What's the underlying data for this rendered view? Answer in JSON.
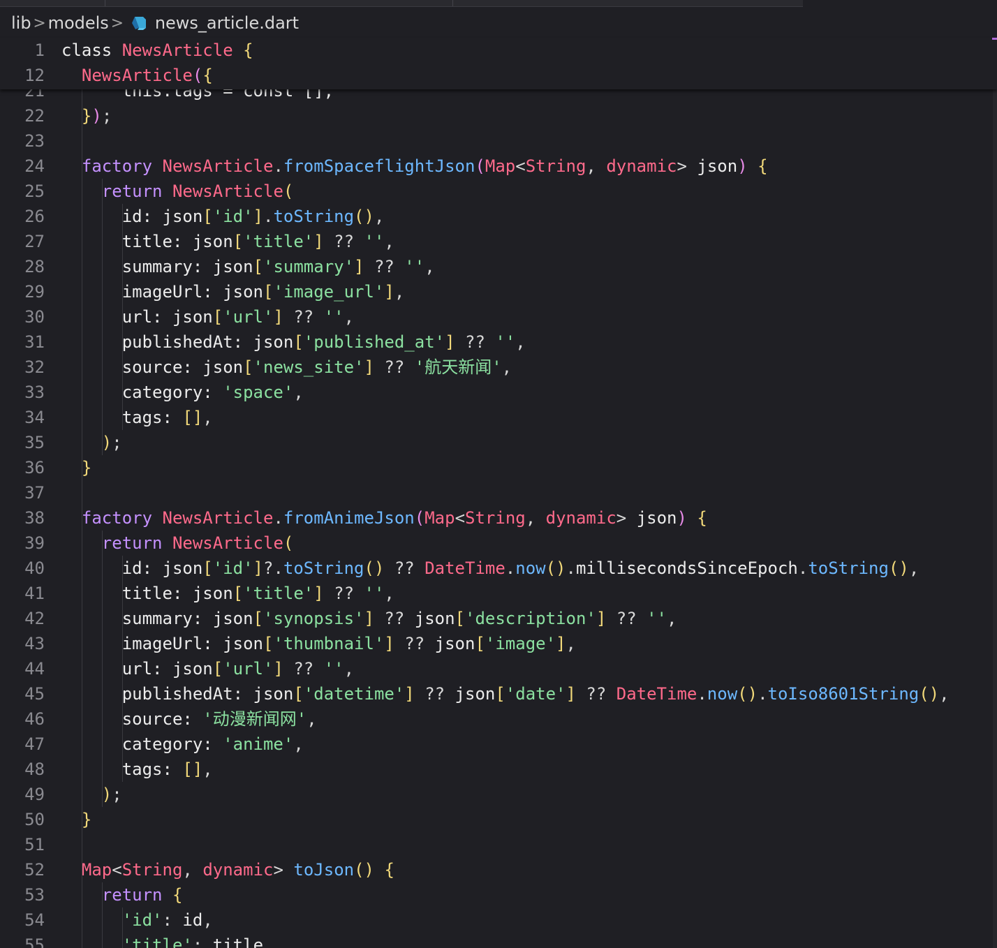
{
  "breadcrumb": {
    "items": [
      "lib",
      "models",
      "news_article.dart"
    ],
    "separator": ">"
  },
  "colors": {
    "background": "#1f1f24",
    "keyword": "#c591ff",
    "class_name": "#ff6a8b",
    "function": "#6db8ff",
    "string": "#8be0a0",
    "bracket": "#f2d97a",
    "line_number": "#8a8a90"
  },
  "editor": {
    "sticky_lines": [
      {
        "n": "1",
        "tokens": [
          [
            "kw-plain",
            "class "
          ],
          [
            "cl",
            "NewsArticle"
          ],
          [
            "pl",
            " "
          ],
          [
            "br",
            "{"
          ]
        ]
      },
      {
        "n": "12",
        "tokens": [
          [
            "pl",
            "  "
          ],
          [
            "cl",
            "NewsArticle"
          ],
          [
            "br2",
            "("
          ],
          [
            "br",
            "{"
          ]
        ]
      }
    ],
    "partial_line": {
      "n": "21",
      "text": "      this.tags = const [],"
    },
    "lines": [
      {
        "n": "22",
        "tokens": [
          [
            "pl",
            "  "
          ],
          [
            "br",
            "}"
          ],
          [
            "br2",
            ")"
          ],
          [
            "op",
            ";"
          ]
        ]
      },
      {
        "n": "23",
        "tokens": []
      },
      {
        "n": "24",
        "tokens": [
          [
            "pl",
            "  "
          ],
          [
            "kw",
            "factory "
          ],
          [
            "cl",
            "NewsArticle"
          ],
          [
            "op",
            "."
          ],
          [
            "fn",
            "fromSpaceflightJson"
          ],
          [
            "br2",
            "("
          ],
          [
            "cl",
            "Map"
          ],
          [
            "op",
            "<"
          ],
          [
            "cl",
            "String"
          ],
          [
            "op",
            ", "
          ],
          [
            "cl",
            "dynamic"
          ],
          [
            "op",
            "> "
          ],
          [
            "pl",
            "json"
          ],
          [
            "br2",
            ")"
          ],
          [
            "pl",
            " "
          ],
          [
            "br",
            "{"
          ]
        ]
      },
      {
        "n": "25",
        "tokens": [
          [
            "pl",
            "    "
          ],
          [
            "kw",
            "return "
          ],
          [
            "cl",
            "NewsArticle"
          ],
          [
            "br",
            "("
          ]
        ]
      },
      {
        "n": "26",
        "tokens": [
          [
            "pl",
            "      id: json"
          ],
          [
            "br",
            "["
          ],
          [
            "st",
            "'id'"
          ],
          [
            "br",
            "]"
          ],
          [
            "op",
            "."
          ],
          [
            "fn",
            "toString"
          ],
          [
            "br",
            "()"
          ],
          [
            "op",
            ","
          ]
        ]
      },
      {
        "n": "27",
        "tokens": [
          [
            "pl",
            "      title: json"
          ],
          [
            "br",
            "["
          ],
          [
            "st",
            "'title'"
          ],
          [
            "br",
            "]"
          ],
          [
            "op",
            " ?? "
          ],
          [
            "st",
            "''"
          ],
          [
            "op",
            ","
          ]
        ]
      },
      {
        "n": "28",
        "tokens": [
          [
            "pl",
            "      summary: json"
          ],
          [
            "br",
            "["
          ],
          [
            "st",
            "'summary'"
          ],
          [
            "br",
            "]"
          ],
          [
            "op",
            " ?? "
          ],
          [
            "st",
            "''"
          ],
          [
            "op",
            ","
          ]
        ]
      },
      {
        "n": "29",
        "tokens": [
          [
            "pl",
            "      imageUrl: json"
          ],
          [
            "br",
            "["
          ],
          [
            "st",
            "'image_url'"
          ],
          [
            "br",
            "]"
          ],
          [
            "op",
            ","
          ]
        ]
      },
      {
        "n": "30",
        "tokens": [
          [
            "pl",
            "      url: json"
          ],
          [
            "br",
            "["
          ],
          [
            "st",
            "'url'"
          ],
          [
            "br",
            "]"
          ],
          [
            "op",
            " ?? "
          ],
          [
            "st",
            "''"
          ],
          [
            "op",
            ","
          ]
        ]
      },
      {
        "n": "31",
        "tokens": [
          [
            "pl",
            "      publishedAt: json"
          ],
          [
            "br",
            "["
          ],
          [
            "st",
            "'published_at'"
          ],
          [
            "br",
            "]"
          ],
          [
            "op",
            " ?? "
          ],
          [
            "st",
            "''"
          ],
          [
            "op",
            ","
          ]
        ]
      },
      {
        "n": "32",
        "tokens": [
          [
            "pl",
            "      source: json"
          ],
          [
            "br",
            "["
          ],
          [
            "st",
            "'news_site'"
          ],
          [
            "br",
            "]"
          ],
          [
            "op",
            " ?? "
          ],
          [
            "st",
            "'航天新闻'"
          ],
          [
            "op",
            ","
          ]
        ]
      },
      {
        "n": "33",
        "tokens": [
          [
            "pl",
            "      category: "
          ],
          [
            "st",
            "'space'"
          ],
          [
            "op",
            ","
          ]
        ]
      },
      {
        "n": "34",
        "tokens": [
          [
            "pl",
            "      tags: "
          ],
          [
            "br",
            "[]"
          ],
          [
            "op",
            ","
          ]
        ]
      },
      {
        "n": "35",
        "tokens": [
          [
            "pl",
            "    "
          ],
          [
            "br",
            ")"
          ],
          [
            "op",
            ";"
          ]
        ]
      },
      {
        "n": "36",
        "tokens": [
          [
            "pl",
            "  "
          ],
          [
            "br",
            "}"
          ]
        ]
      },
      {
        "n": "37",
        "tokens": []
      },
      {
        "n": "38",
        "tokens": [
          [
            "pl",
            "  "
          ],
          [
            "kw",
            "factory "
          ],
          [
            "cl",
            "NewsArticle"
          ],
          [
            "op",
            "."
          ],
          [
            "fn",
            "fromAnimeJson"
          ],
          [
            "br2",
            "("
          ],
          [
            "cl",
            "Map"
          ],
          [
            "op",
            "<"
          ],
          [
            "cl",
            "String"
          ],
          [
            "op",
            ", "
          ],
          [
            "cl",
            "dynamic"
          ],
          [
            "op",
            "> "
          ],
          [
            "pl",
            "json"
          ],
          [
            "br2",
            ")"
          ],
          [
            "pl",
            " "
          ],
          [
            "br",
            "{"
          ]
        ]
      },
      {
        "n": "39",
        "tokens": [
          [
            "pl",
            "    "
          ],
          [
            "kw",
            "return "
          ],
          [
            "cl",
            "NewsArticle"
          ],
          [
            "br",
            "("
          ]
        ]
      },
      {
        "n": "40",
        "tokens": [
          [
            "pl",
            "      id: json"
          ],
          [
            "br",
            "["
          ],
          [
            "st",
            "'id'"
          ],
          [
            "br",
            "]"
          ],
          [
            "op",
            "?."
          ],
          [
            "fn",
            "toString"
          ],
          [
            "br",
            "()"
          ],
          [
            "op",
            " ?? "
          ],
          [
            "cl",
            "DateTime"
          ],
          [
            "op",
            "."
          ],
          [
            "fn",
            "now"
          ],
          [
            "br",
            "()"
          ],
          [
            "op",
            "."
          ],
          [
            "pl",
            "millisecondsSinceEpoch"
          ],
          [
            "op",
            "."
          ],
          [
            "fn",
            "toString"
          ],
          [
            "br",
            "()"
          ],
          [
            "op",
            ","
          ]
        ]
      },
      {
        "n": "41",
        "tokens": [
          [
            "pl",
            "      title: json"
          ],
          [
            "br",
            "["
          ],
          [
            "st",
            "'title'"
          ],
          [
            "br",
            "]"
          ],
          [
            "op",
            " ?? "
          ],
          [
            "st",
            "''"
          ],
          [
            "op",
            ","
          ]
        ]
      },
      {
        "n": "42",
        "tokens": [
          [
            "pl",
            "      summary: json"
          ],
          [
            "br",
            "["
          ],
          [
            "st",
            "'synopsis'"
          ],
          [
            "br",
            "]"
          ],
          [
            "op",
            " ?? "
          ],
          [
            "pl",
            "json"
          ],
          [
            "br",
            "["
          ],
          [
            "st",
            "'description'"
          ],
          [
            "br",
            "]"
          ],
          [
            "op",
            " ?? "
          ],
          [
            "st",
            "''"
          ],
          [
            "op",
            ","
          ]
        ]
      },
      {
        "n": "43",
        "tokens": [
          [
            "pl",
            "      imageUrl: json"
          ],
          [
            "br",
            "["
          ],
          [
            "st",
            "'thumbnail'"
          ],
          [
            "br",
            "]"
          ],
          [
            "op",
            " ?? "
          ],
          [
            "pl",
            "json"
          ],
          [
            "br",
            "["
          ],
          [
            "st",
            "'image'"
          ],
          [
            "br",
            "]"
          ],
          [
            "op",
            ","
          ]
        ]
      },
      {
        "n": "44",
        "tokens": [
          [
            "pl",
            "      url: json"
          ],
          [
            "br",
            "["
          ],
          [
            "st",
            "'url'"
          ],
          [
            "br",
            "]"
          ],
          [
            "op",
            " ?? "
          ],
          [
            "st",
            "''"
          ],
          [
            "op",
            ","
          ]
        ]
      },
      {
        "n": "45",
        "tokens": [
          [
            "pl",
            "      publishedAt: json"
          ],
          [
            "br",
            "["
          ],
          [
            "st",
            "'datetime'"
          ],
          [
            "br",
            "]"
          ],
          [
            "op",
            " ?? "
          ],
          [
            "pl",
            "json"
          ],
          [
            "br",
            "["
          ],
          [
            "st",
            "'date'"
          ],
          [
            "br",
            "]"
          ],
          [
            "op",
            " ?? "
          ],
          [
            "cl",
            "DateTime"
          ],
          [
            "op",
            "."
          ],
          [
            "fn",
            "now"
          ],
          [
            "br",
            "()"
          ],
          [
            "op",
            "."
          ],
          [
            "fn",
            "toIso8601String"
          ],
          [
            "br",
            "()"
          ],
          [
            "op",
            ","
          ]
        ]
      },
      {
        "n": "46",
        "tokens": [
          [
            "pl",
            "      source: "
          ],
          [
            "st",
            "'动漫新闻网'"
          ],
          [
            "op",
            ","
          ]
        ]
      },
      {
        "n": "47",
        "tokens": [
          [
            "pl",
            "      category: "
          ],
          [
            "st",
            "'anime'"
          ],
          [
            "op",
            ","
          ]
        ]
      },
      {
        "n": "48",
        "tokens": [
          [
            "pl",
            "      tags: "
          ],
          [
            "br",
            "[]"
          ],
          [
            "op",
            ","
          ]
        ]
      },
      {
        "n": "49",
        "tokens": [
          [
            "pl",
            "    "
          ],
          [
            "br",
            ")"
          ],
          [
            "op",
            ";"
          ]
        ]
      },
      {
        "n": "50",
        "tokens": [
          [
            "pl",
            "  "
          ],
          [
            "br",
            "}"
          ]
        ]
      },
      {
        "n": "51",
        "tokens": []
      },
      {
        "n": "52",
        "tokens": [
          [
            "pl",
            "  "
          ],
          [
            "cl",
            "Map"
          ],
          [
            "op",
            "<"
          ],
          [
            "cl",
            "String"
          ],
          [
            "op",
            ", "
          ],
          [
            "cl",
            "dynamic"
          ],
          [
            "op",
            "> "
          ],
          [
            "fn",
            "toJson"
          ],
          [
            "br",
            "()"
          ],
          [
            "pl",
            " "
          ],
          [
            "br",
            "{"
          ]
        ]
      },
      {
        "n": "53",
        "tokens": [
          [
            "pl",
            "    "
          ],
          [
            "kw",
            "return "
          ],
          [
            "br",
            "{"
          ]
        ]
      },
      {
        "n": "54",
        "tokens": [
          [
            "pl",
            "      "
          ],
          [
            "st",
            "'id'"
          ],
          [
            "op",
            ": "
          ],
          [
            "pl",
            "id"
          ],
          [
            "op",
            ","
          ]
        ]
      },
      {
        "n": "55",
        "tokens": [
          [
            "pl",
            "      "
          ],
          [
            "st",
            "'title'"
          ],
          [
            "op",
            ": "
          ],
          [
            "pl",
            "title"
          ],
          [
            "op",
            ","
          ]
        ]
      }
    ]
  }
}
